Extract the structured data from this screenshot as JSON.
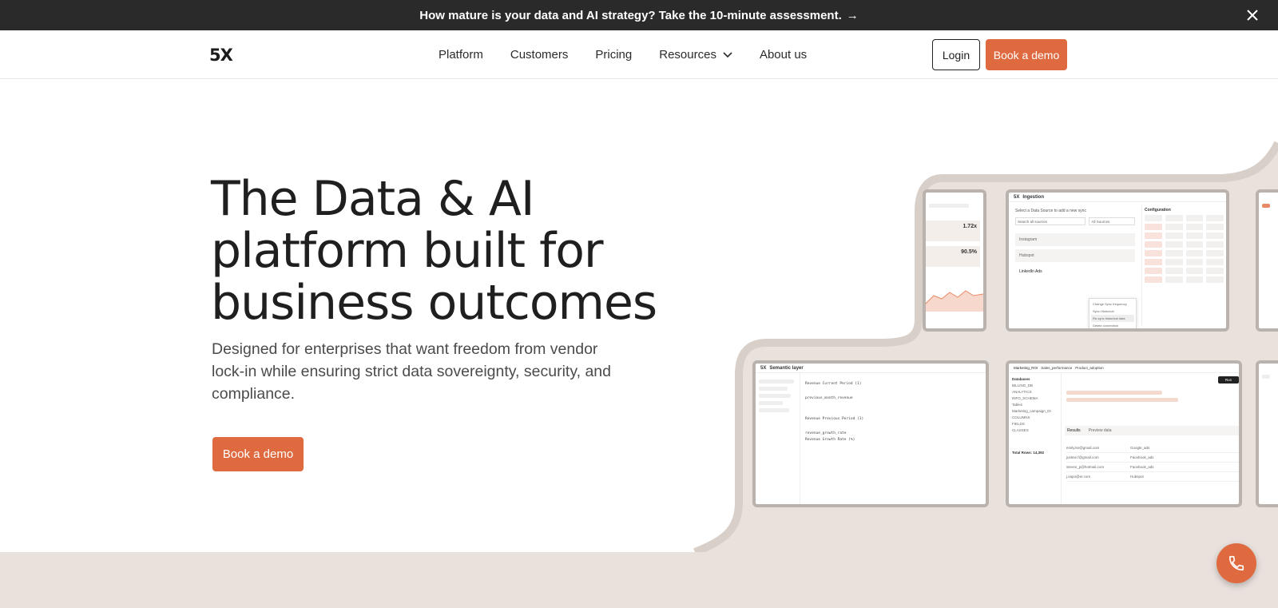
{
  "announcement": {
    "text": "How mature is your data and AI strategy? Take the 10-minute assessment.",
    "arrow": "→",
    "close_icon": "close-icon"
  },
  "nav": {
    "logo": "5X",
    "items": [
      {
        "label": "Platform"
      },
      {
        "label": "Customers"
      },
      {
        "label": "Pricing"
      },
      {
        "label": "Resources",
        "has_dropdown": true
      },
      {
        "label": "About us"
      }
    ],
    "login_label": "Login",
    "demo_label": "Book a demo"
  },
  "hero": {
    "title": "The Data & AI platform built for business outcomes",
    "subtitle": "Designed for enterprises that want freedom from vendor lock-in while ensuring strict data sovereignty, security, and compliance.",
    "cta_label": "Book a demo"
  },
  "mockups": {
    "ingestion": {
      "title": "Ingestion",
      "prompt": "Select a Data Source to add a new sync",
      "search_placeholder": "Search all sources",
      "filter": "All Sources",
      "sources": [
        "Instagram",
        "Hubspot",
        "LinkedIn Ads"
      ],
      "config_title": "Configuration",
      "menu": [
        "Change Sync frequency",
        "Sync Historical",
        "Re-sync historical data",
        "Delete connection"
      ]
    },
    "semantic": {
      "title": "Semantic layer",
      "code": [
        "Revenue Current Period (1)",
        "previous_month_revenue",
        "Revenue Previous Period (1)",
        "revenue_growth_rate",
        "Revenue Growth Rate (%)"
      ]
    },
    "query": {
      "tab": "Marketing_ROI",
      "tab2": "Sales_performance",
      "tab3": "Product_adoption",
      "db_title": "Databases",
      "dbs": [
        "BILLING_DB",
        "ANALYTICS",
        "INFO_SCHEMA",
        "Tables",
        "Marketing_campaign_DI",
        "COLUMNS",
        "FIELDS",
        "CLASSES"
      ],
      "run": "Run",
      "results": "Results",
      "preview": "Preview data",
      "total": "Total Rows: 14,392",
      "rows": [
        [
          "emily.ke@gmail.com",
          "Google_ads"
        ],
        [
          "justine.f@gmail.com",
          "Facebook_ads"
        ],
        [
          "steven_p@hotmail.com",
          "Facebook_ads"
        ],
        [
          "j.sapo@er.com",
          "Hubspot"
        ]
      ]
    },
    "stats": {
      "value1": "1.72x",
      "value2": "90.5%"
    }
  },
  "colors": {
    "accent": "#e06a3f",
    "dark": "#2a2a2a",
    "beige": "#e9e1dc"
  },
  "fab_icon": "phone-icon"
}
